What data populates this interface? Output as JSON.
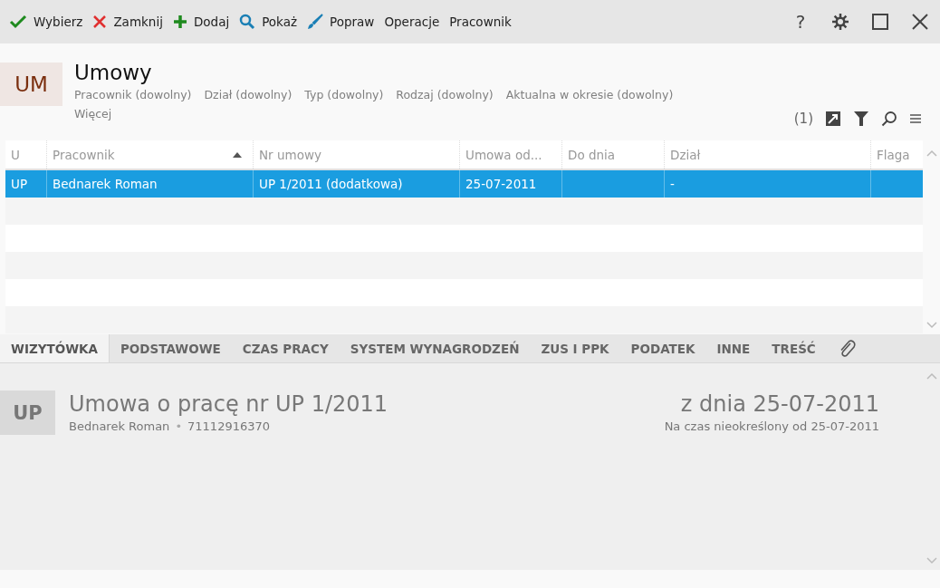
{
  "toolbar": {
    "items": [
      {
        "label": "Wybierz",
        "kind": "check"
      },
      {
        "label": "Zamknij",
        "kind": "cross"
      },
      {
        "label": "Dodaj",
        "kind": "plus"
      },
      {
        "label": "Pokaż",
        "kind": "search"
      },
      {
        "label": "Popraw",
        "kind": "brush"
      },
      {
        "label": "Operacje",
        "kind": "text"
      },
      {
        "label": "Pracownik",
        "kind": "text"
      }
    ],
    "help": "?"
  },
  "header": {
    "badge": "UM",
    "title": "Umowy",
    "filters": [
      "Pracownik (dowolny)",
      "Dział (dowolny)",
      "Typ (dowolny)",
      "Rodzaj (dowolny)",
      "Aktualna w okresie (dowolny)"
    ],
    "more": "Więcej",
    "count": "(1)"
  },
  "table": {
    "columns": [
      {
        "label": "U",
        "sorted": false
      },
      {
        "label": "Pracownik",
        "sorted": true
      },
      {
        "label": "Nr umowy",
        "sorted": false
      },
      {
        "label": "Umowa od...",
        "sorted": false
      },
      {
        "label": "Do dnia",
        "sorted": false
      },
      {
        "label": "Dział",
        "sorted": false
      },
      {
        "label": "Flaga",
        "sorted": false
      }
    ],
    "rows": [
      {
        "cells": [
          "UP",
          "Bednarek Roman",
          "UP 1/2011 (dodatkowa)",
          "25-07-2011",
          "",
          "-",
          ""
        ],
        "selected": true
      }
    ]
  },
  "tabs": [
    {
      "label": "WIZYTÓWKA",
      "selected": true
    },
    {
      "label": "PODSTAWOWE",
      "selected": false
    },
    {
      "label": "CZAS PRACY",
      "selected": false
    },
    {
      "label": "SYSTEM WYNAGRODZEŃ",
      "selected": false
    },
    {
      "label": "ZUS I PPK",
      "selected": false
    },
    {
      "label": "PODATEK",
      "selected": false
    },
    {
      "label": "INNE",
      "selected": false
    },
    {
      "label": "TREŚĆ",
      "selected": false
    }
  ],
  "card": {
    "badge": "UP",
    "title": "Umowa o pracę nr UP 1/2011",
    "employee": "Bednarek Roman",
    "separator": "•",
    "pesel": "71112916370",
    "date": "z dnia 25-07-2011",
    "period": "Na czas nieokreślony od 25-07-2011"
  }
}
